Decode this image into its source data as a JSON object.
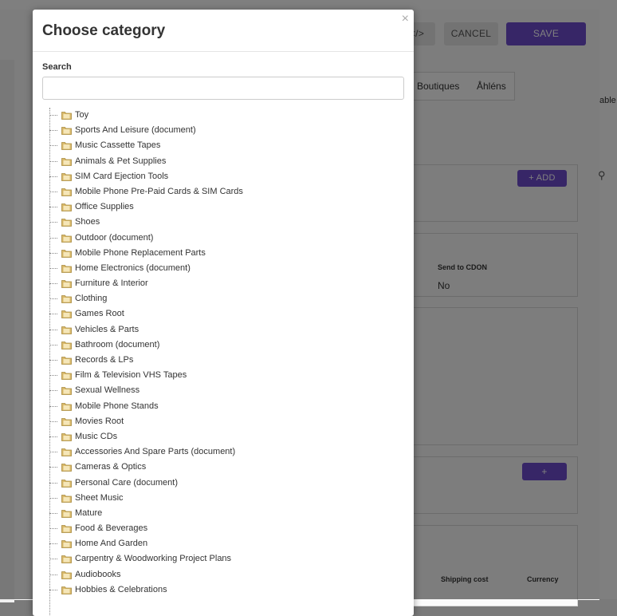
{
  "background": {
    "code_button": "</>",
    "cancel_label": "CANCEL",
    "save_label": "SAVE",
    "tabs": [
      "Boutiques",
      "Åhléns"
    ],
    "add_label": "+ ADD",
    "plus_label": "+",
    "col_send_to_cdon": "Send to CDON",
    "val_send_to_cdon": "No",
    "col_shipping_cost": "Shipping cost",
    "col_currency": "Currency",
    "right_cut_text": "able"
  },
  "modal": {
    "title": "Choose category",
    "close_glyph": "×",
    "search_label": "Search",
    "search_value": "",
    "categories": [
      "Toy",
      "Sports And Leisure (document)",
      "Music Cassette Tapes",
      "Animals & Pet Supplies",
      "SIM Card Ejection Tools",
      "Mobile Phone Pre-Paid Cards & SIM Cards",
      "Office Supplies",
      "Shoes",
      "Outdoor (document)",
      "Mobile Phone Replacement Parts",
      "Home Electronics (document)",
      "Furniture & Interior",
      "Clothing",
      "Games Root",
      "Vehicles & Parts",
      "Bathroom (document)",
      "Records & LPs",
      "Film & Television VHS Tapes",
      "Sexual Wellness",
      "Mobile Phone Stands",
      "Movies Root",
      "Music CDs",
      "Accessories And Spare Parts (document)",
      "Cameras & Optics",
      "Personal Care (document)",
      "Sheet Music",
      "Mature",
      "Food & Beverages",
      "Home And Garden",
      "Carpentry & Woodworking Project Plans",
      "Audiobooks",
      "Hobbies & Celebrations"
    ]
  },
  "colors": {
    "accent": "#6f4ccf",
    "folder": "#d9b96a"
  },
  "icons": {
    "folder": "folder-icon",
    "close": "close-icon",
    "search_bg": "search-icon"
  }
}
